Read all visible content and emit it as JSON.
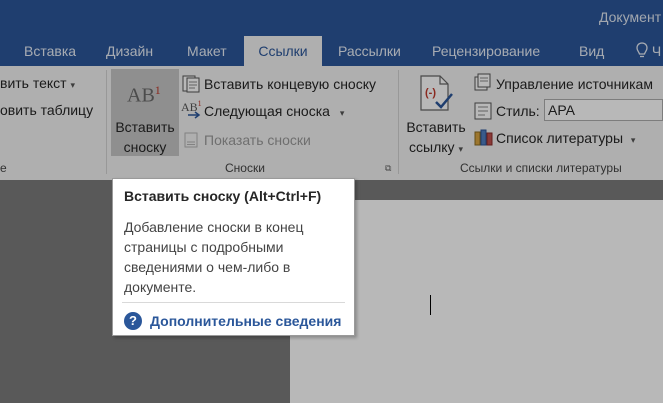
{
  "window": {
    "title": "Документ"
  },
  "tabs": [
    {
      "label": "Вставка"
    },
    {
      "label": "Дизайн"
    },
    {
      "label": "Макет"
    },
    {
      "label": "Ссылки"
    },
    {
      "label": "Рассылки"
    },
    {
      "label": "Рецензирование"
    },
    {
      "label": "Вид"
    }
  ],
  "tell_me": {
    "label": "Ч"
  },
  "ribbon": {
    "toc_group": {
      "add_text": "вить текст",
      "update_table": "овить таблицу",
      "group_label": "е"
    },
    "footnotes_group": {
      "insert_footnote_line1": "Вставить",
      "insert_footnote_line2": "сноску",
      "big_icon_text": "AB",
      "big_icon_sup": "1",
      "insert_endnote": "Вставить концевую сноску",
      "next_footnote": "Следующая сноска",
      "show_notes": "Показать сноски",
      "group_label": "Сноски",
      "small_icon_text": "AB",
      "small_icon_sup": "1"
    },
    "citations_group": {
      "insert_citation_line1": "Вставить",
      "insert_citation_line2": "ссылку",
      "manage_sources": "Управление источникам",
      "style_label": "Стиль:",
      "style_value": "APA",
      "bibliography": "Список литературы",
      "group_label": "Ссылки и списки литературы"
    }
  },
  "tooltip": {
    "title": "Вставить сноску (Alt+Ctrl+F)",
    "description": "Добавление сноски в конец страницы с подробными сведениями о чем-либо в документе.",
    "help_icon": "?",
    "more_info": "Дополнительные сведения"
  },
  "colors": {
    "accent": "#2b579a",
    "ribbon_bg": "#f3f3f3",
    "citation_icon_red": "#c0392b"
  }
}
